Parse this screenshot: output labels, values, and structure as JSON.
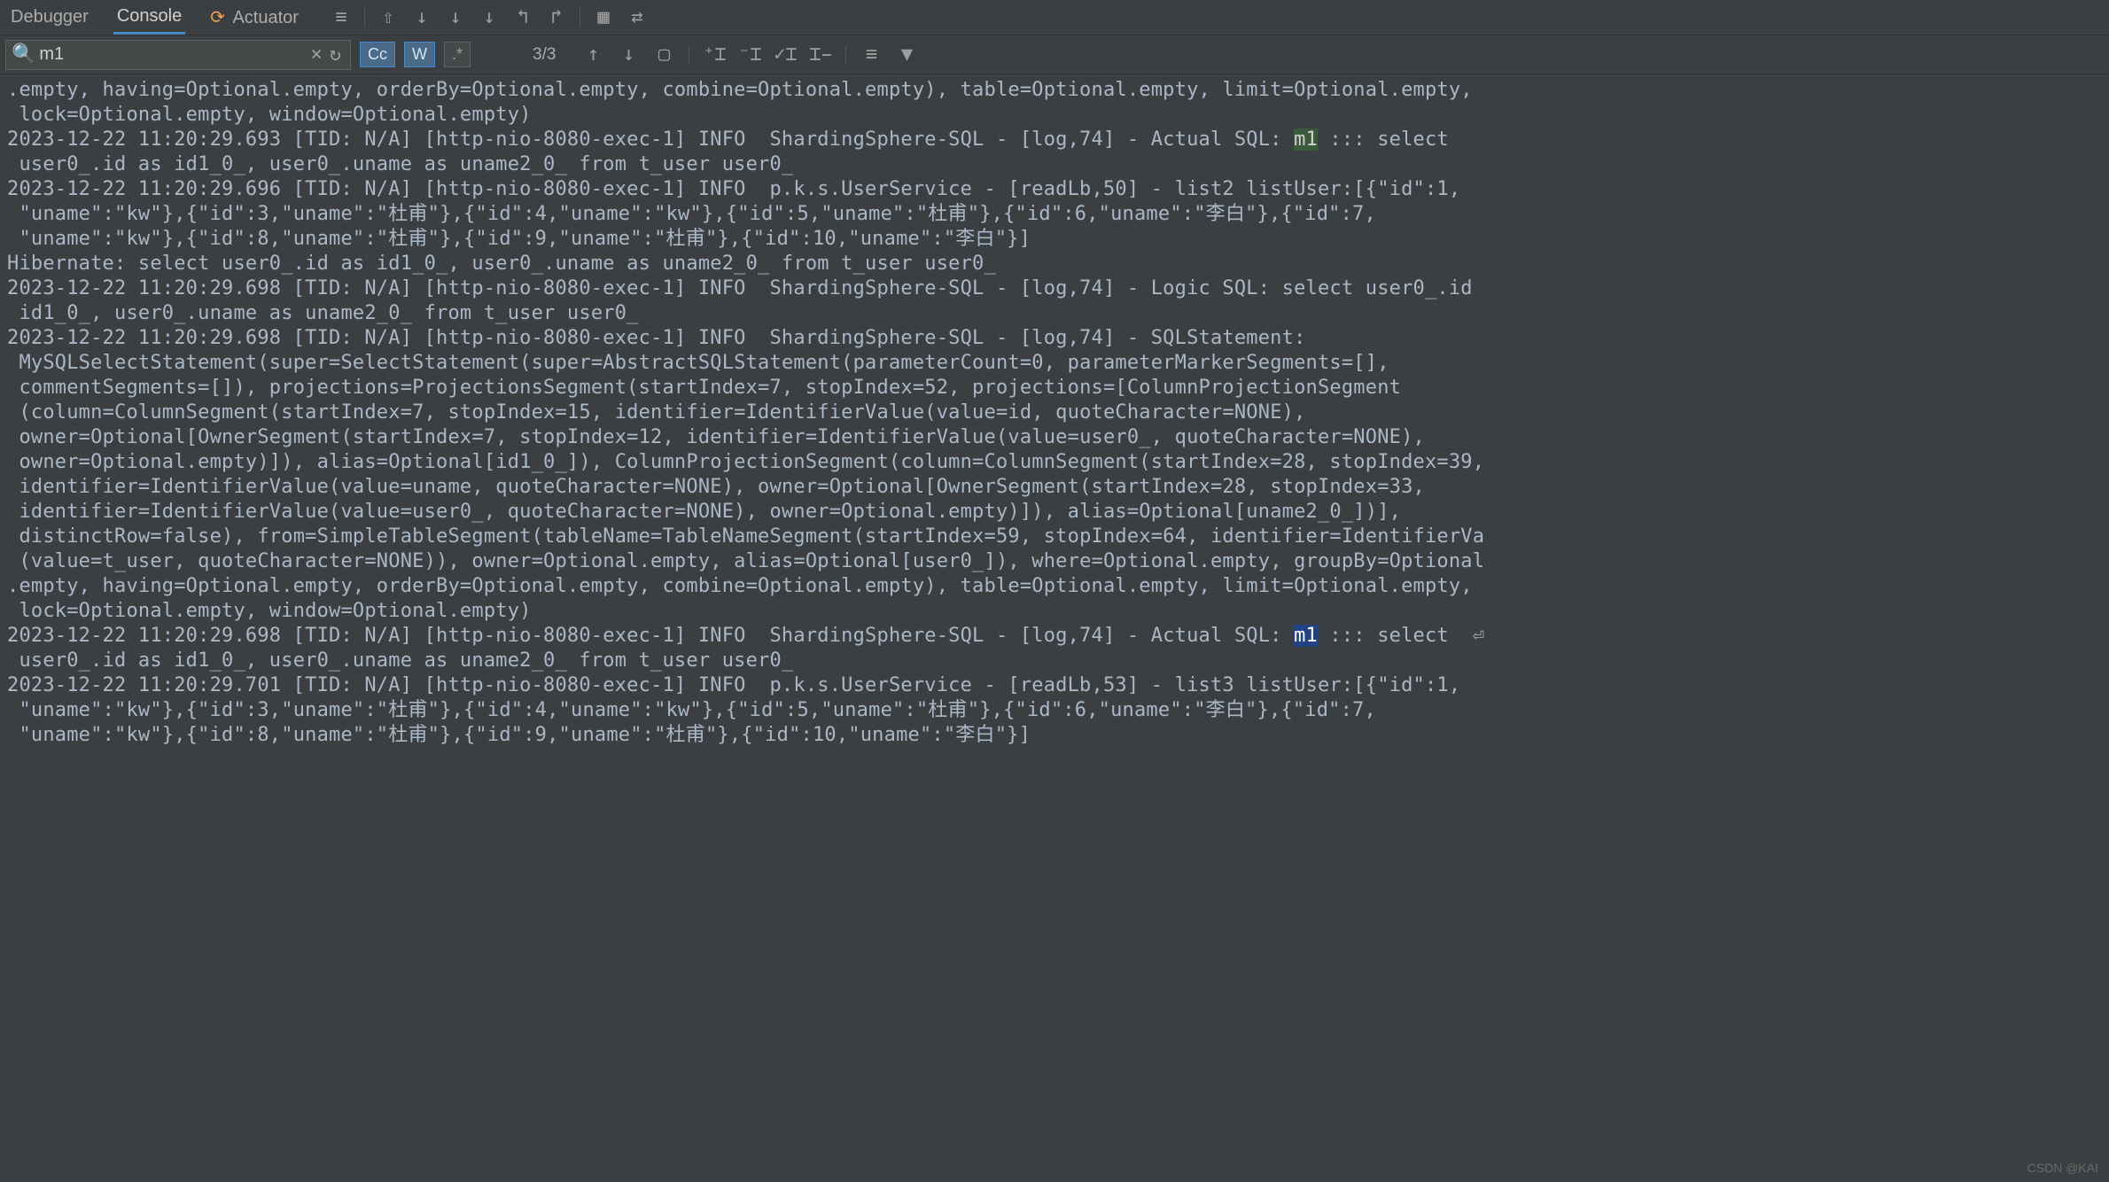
{
  "tabs": {
    "debugger": "Debugger",
    "console": "Console",
    "actuator": "Actuator"
  },
  "search": {
    "value": "m1",
    "match_count": "3/3",
    "cc": "Cc",
    "w": "W",
    "star": ".*"
  },
  "console_lines": [
    {
      "text": ".empty, having=Optional.empty, orderBy=Optional.empty, combine=Optional.empty), table=Optional.empty, limit=Optional.empty,"
    },
    {
      "text": " lock=Optional.empty, window=Optional.empty)"
    },
    {
      "parts": [
        {
          "t": "2023-12-22 11:20:29.693 [TID: N/A] [http-nio-8080-exec-1] INFO  ShardingSphere-SQL - [log,74] - Actual SQL: "
        },
        {
          "t": "m1",
          "hl": true
        },
        {
          "t": " ::: select"
        }
      ]
    },
    {
      "text": " user0_.id as id1_0_, user0_.uname as uname2_0_ from t_user user0_"
    },
    {
      "text": "2023-12-22 11:20:29.696 [TID: N/A] [http-nio-8080-exec-1] INFO  p.k.s.UserService - [readLb,50] - list2 listUser:[{\"id\":1,"
    },
    {
      "text": " \"uname\":\"kw\"},{\"id\":3,\"uname\":\"杜甫\"},{\"id\":4,\"uname\":\"kw\"},{\"id\":5,\"uname\":\"杜甫\"},{\"id\":6,\"uname\":\"李白\"},{\"id\":7,"
    },
    {
      "text": " \"uname\":\"kw\"},{\"id\":8,\"uname\":\"杜甫\"},{\"id\":9,\"uname\":\"杜甫\"},{\"id\":10,\"uname\":\"李白\"}]"
    },
    {
      "text": "Hibernate: select user0_.id as id1_0_, user0_.uname as uname2_0_ from t_user user0_"
    },
    {
      "text": "2023-12-22 11:20:29.698 [TID: N/A] [http-nio-8080-exec-1] INFO  ShardingSphere-SQL - [log,74] - Logic SQL: select user0_.id"
    },
    {
      "text": " id1_0_, user0_.uname as uname2_0_ from t_user user0_"
    },
    {
      "text": "2023-12-22 11:20:29.698 [TID: N/A] [http-nio-8080-exec-1] INFO  ShardingSphere-SQL - [log,74] - SQLStatement:"
    },
    {
      "text": " MySQLSelectStatement(super=SelectStatement(super=AbstractSQLStatement(parameterCount=0, parameterMarkerSegments=[],"
    },
    {
      "text": " commentSegments=[]), projections=ProjectionsSegment(startIndex=7, stopIndex=52, projections=[ColumnProjectionSegment"
    },
    {
      "text": " (column=ColumnSegment(startIndex=7, stopIndex=15, identifier=IdentifierValue(value=id, quoteCharacter=NONE),"
    },
    {
      "text": " owner=Optional[OwnerSegment(startIndex=7, stopIndex=12, identifier=IdentifierValue(value=user0_, quoteCharacter=NONE),"
    },
    {
      "text": " owner=Optional.empty)]), alias=Optional[id1_0_]), ColumnProjectionSegment(column=ColumnSegment(startIndex=28, stopIndex=39,"
    },
    {
      "text": " identifier=IdentifierValue(value=uname, quoteCharacter=NONE), owner=Optional[OwnerSegment(startIndex=28, stopIndex=33,"
    },
    {
      "text": " identifier=IdentifierValue(value=user0_, quoteCharacter=NONE), owner=Optional.empty)]), alias=Optional[uname2_0_])],"
    },
    {
      "text": " distinctRow=false), from=SimpleTableSegment(tableName=TableNameSegment(startIndex=59, stopIndex=64, identifier=IdentifierVa"
    },
    {
      "text": " (value=t_user, quoteCharacter=NONE)), owner=Optional.empty, alias=Optional[user0_]), where=Optional.empty, groupBy=Optional"
    },
    {
      "text": ".empty, having=Optional.empty, orderBy=Optional.empty, combine=Optional.empty), table=Optional.empty, limit=Optional.empty,"
    },
    {
      "text": " lock=Optional.empty, window=Optional.empty)"
    },
    {
      "parts": [
        {
          "t": "2023-12-22 11:20:29.698 [TID: N/A] [http-nio-8080-exec-1] INFO  ShardingSphere-SQL - [log,74] - Actual SQL: "
        },
        {
          "t": "m1",
          "hl": true,
          "current": true
        },
        {
          "t": " ::: select  ⏎"
        }
      ]
    },
    {
      "text": " user0_.id as id1_0_, user0_.uname as uname2_0_ from t_user user0_"
    },
    {
      "text": "2023-12-22 11:20:29.701 [TID: N/A] [http-nio-8080-exec-1] INFO  p.k.s.UserService - [readLb,53] - list3 listUser:[{\"id\":1,"
    },
    {
      "text": " \"uname\":\"kw\"},{\"id\":3,\"uname\":\"杜甫\"},{\"id\":4,\"uname\":\"kw\"},{\"id\":5,\"uname\":\"杜甫\"},{\"id\":6,\"uname\":\"李白\"},{\"id\":7,"
    },
    {
      "text": " \"uname\":\"kw\"},{\"id\":8,\"uname\":\"杜甫\"},{\"id\":9,\"uname\":\"杜甫\"},{\"id\":10,\"uname\":\"李白\"}]"
    }
  ],
  "watermark": "CSDN @KAI"
}
